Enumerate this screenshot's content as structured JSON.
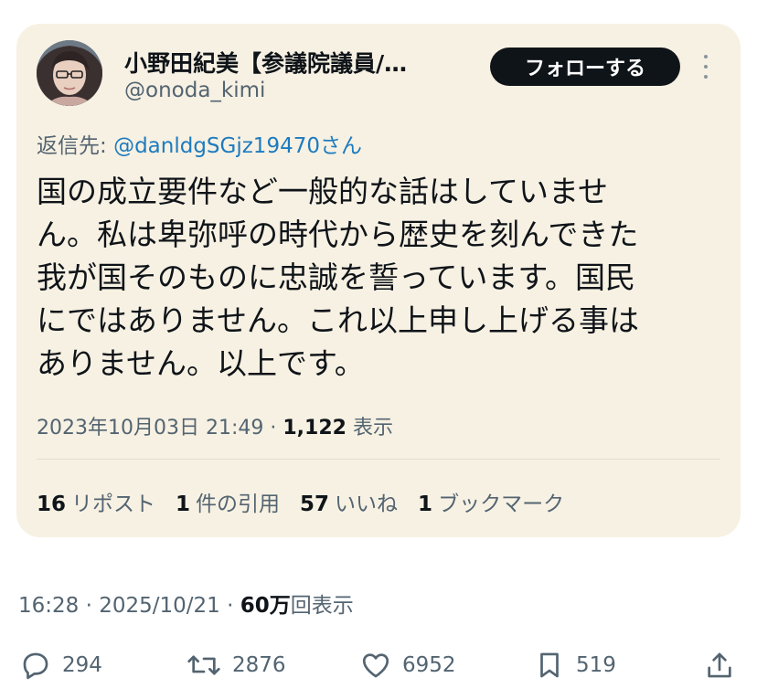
{
  "quoted_tweet": {
    "author_name": "小野田紀美【参議院議員/…",
    "author_handle": "@onoda_kimi",
    "follow_label": "フォローする",
    "reply_prefix": "返信先: ",
    "reply_mention": "@danldgSGjz19470さん",
    "text_lines": [
      "国の成立要件など一般的な話はしていませ",
      "ん。私は卑弥呼の時代から歴史を刻んできた",
      "我が国そのものに忠誠を誓っています。国民",
      "にではありません。これ以上申し上げる事は",
      "ありません。以上です。"
    ],
    "timestamp": "2023年10月03日 21:49",
    "separator": " · ",
    "views_count": "1,122",
    "views_label": " 表示",
    "stats": [
      {
        "count": "16",
        "label": "リポスト"
      },
      {
        "count": "1",
        "label": "件の引用"
      },
      {
        "count": "57",
        "label": "いいね"
      },
      {
        "count": "1",
        "label": "ブックマーク"
      }
    ]
  },
  "post": {
    "time": "16:28 · 2025/10/21 · ",
    "views_count": "60万",
    "views_label": "回表示"
  },
  "actions": {
    "replies": "294",
    "reposts": "2876",
    "likes": "6952",
    "bookmarks": "519"
  },
  "icons": {
    "reply": "reply-icon",
    "repost": "repost-icon",
    "like": "heart-icon",
    "bookmark": "bookmark-icon",
    "share": "share-icon",
    "more": "more-icon"
  },
  "colors": {
    "card_bg": "#f7f1e3",
    "mention": "#1d7bbf",
    "follow_bg": "#0f1419",
    "muted": "#536471"
  }
}
